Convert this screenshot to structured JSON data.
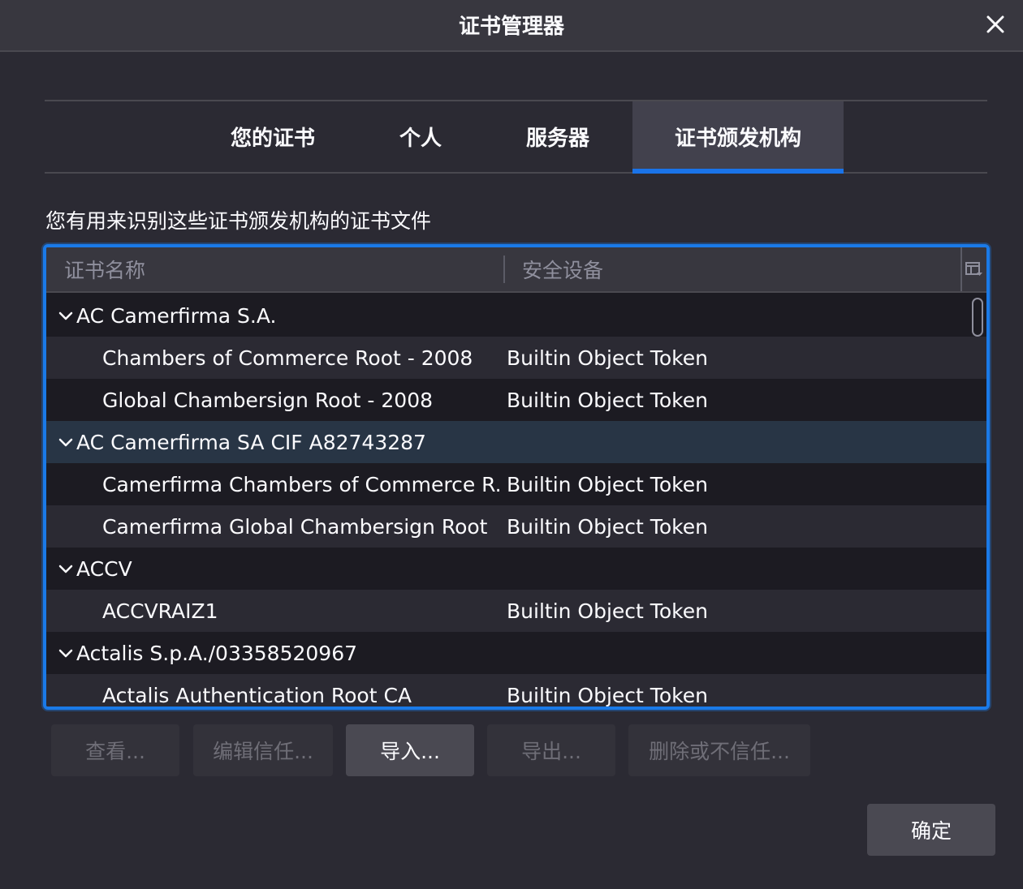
{
  "dialog": {
    "title": "证书管理器",
    "close_icon": "close-icon"
  },
  "tabs": [
    {
      "label": "您的证书",
      "selected": false
    },
    {
      "label": "个人",
      "selected": false
    },
    {
      "label": "服务器",
      "selected": false
    },
    {
      "label": "证书颁发机构",
      "selected": true
    }
  ],
  "description": "您有用来识别这些证书颁发机构的证书文件",
  "tree": {
    "columns": [
      {
        "label": "证书名称"
      },
      {
        "label": "安全设备"
      }
    ],
    "column_picker_icon": "column-picker-icon",
    "rows": [
      {
        "type": "group",
        "name": "AC Camerfirma S.A.",
        "expanded": true
      },
      {
        "type": "cert",
        "name": "Chambers of Commerce Root - 2008",
        "token": "Builtin Object Token"
      },
      {
        "type": "cert",
        "name": "Global Chambersign Root - 2008",
        "token": "Builtin Object Token"
      },
      {
        "type": "group",
        "name": "AC Camerfirma SA CIF A82743287",
        "expanded": true,
        "selected": true
      },
      {
        "type": "cert",
        "name": "Camerfirma Chambers of Commerce R...",
        "token": "Builtin Object Token"
      },
      {
        "type": "cert",
        "name": "Camerfirma Global Chambersign Root",
        "token": "Builtin Object Token"
      },
      {
        "type": "group",
        "name": "ACCV",
        "expanded": true
      },
      {
        "type": "cert",
        "name": "ACCVRAIZ1",
        "token": "Builtin Object Token"
      },
      {
        "type": "group",
        "name": "Actalis S.p.A./03358520967",
        "expanded": true
      },
      {
        "type": "cert",
        "name": "Actalis Authentication Root CA",
        "token": "Builtin Object Token"
      }
    ]
  },
  "buttons": {
    "view": "查看...",
    "edit_trust": "编辑信任...",
    "import": "导入...",
    "export": "导出...",
    "delete_distrust": "删除或不信任...",
    "ok": "确定"
  },
  "colors": {
    "accent": "#1a7ae8",
    "background": "#2b2a33",
    "selected_row": "#283545"
  }
}
